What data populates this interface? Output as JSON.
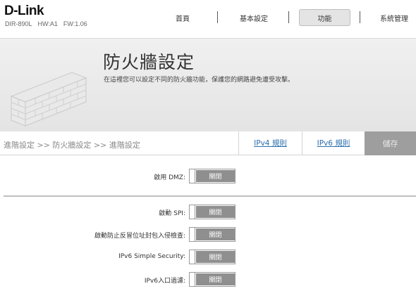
{
  "brand": {
    "logo": "D-Link",
    "model": "DIR-890L",
    "hw": "HW:A1",
    "fw": "FW:1.06"
  },
  "nav": {
    "items": [
      {
        "label": "首頁"
      },
      {
        "label": "基本設定"
      },
      {
        "label": "功能"
      },
      {
        "label": "系統管理"
      }
    ]
  },
  "banner": {
    "title": "防火牆設定",
    "description": "在這裡您可以設定不同的防火牆功能，保護您的網路避免遭受攻擊。",
    "icon": "brick-wall-icon"
  },
  "subbar": {
    "breadcrumb": "進階設定 >> 防火牆設定 >> 進階設定",
    "tabs": [
      {
        "label": "IPv4 規則"
      },
      {
        "label": "IPv6 規則"
      }
    ],
    "save_label": "儲存"
  },
  "settings": [
    {
      "label": "啟用 DMZ:",
      "value": "關閉"
    },
    {
      "label": "啟動 SPI:",
      "value": "關閉"
    },
    {
      "label": "啟動防止反冒位址封包入侵檢查:",
      "value": "關閉"
    },
    {
      "label": "IPv6 Simple Security:",
      "value": "關閉"
    },
    {
      "label": "IPv6入口過濾:",
      "value": "關閉"
    }
  ],
  "colors": {
    "link": "#2a6fae",
    "toggle_off": "#8f8f8f",
    "save_bg": "#9e9e9e"
  }
}
